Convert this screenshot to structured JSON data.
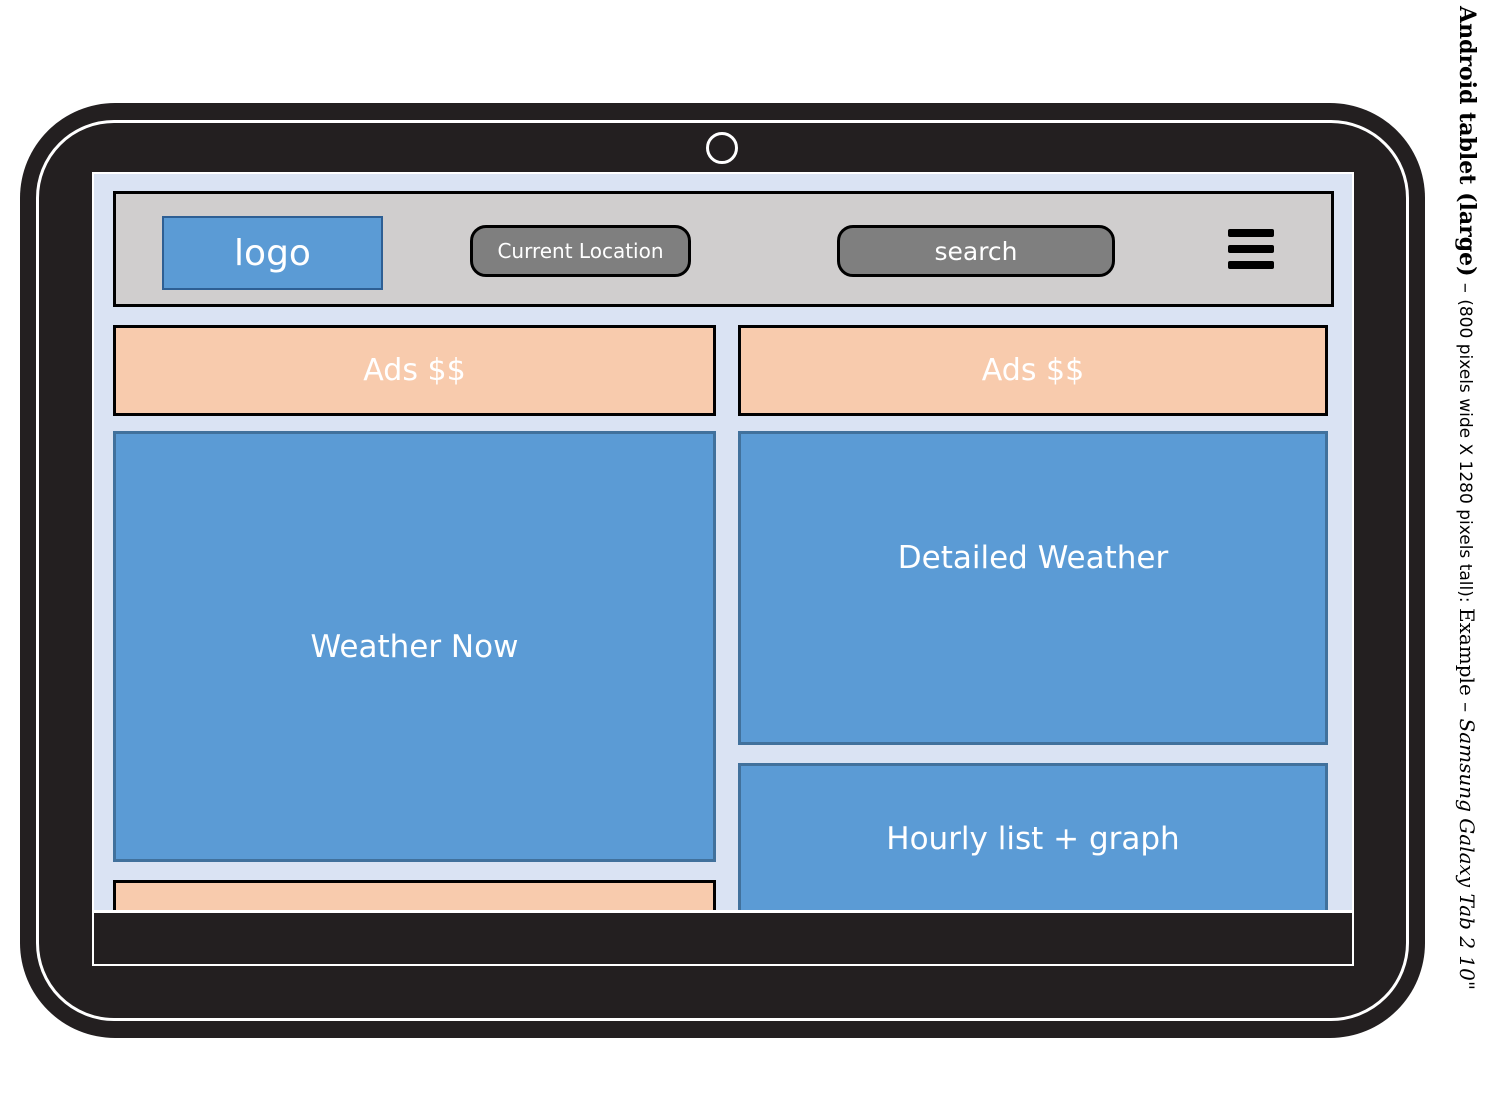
{
  "header": {
    "logo": "logo",
    "current_location": "Current Location",
    "search": "search",
    "menu_icon": "hamburger-menu-icon"
  },
  "ads": {
    "left": "Ads $$",
    "right": "Ads $$"
  },
  "panels": {
    "weather_now": "Weather Now",
    "detailed_weather": "Detailed Weather",
    "hourly": "Hourly list + graph"
  },
  "caption": {
    "title": "Android tablet (large)",
    "dash1": " – ",
    "dims": "(800 pixels wide X 1280 pixels tall): ",
    "example": "Example – ",
    "device": "Samsung Galaxy Tab 2 10\""
  },
  "colors": {
    "device": "#231f20",
    "screen": "#dae3f3",
    "header": "#d0cece",
    "panel_blue": "#5b9bd5",
    "ad_peach": "#f8cbad",
    "pill_gray": "#7f7f7f"
  }
}
